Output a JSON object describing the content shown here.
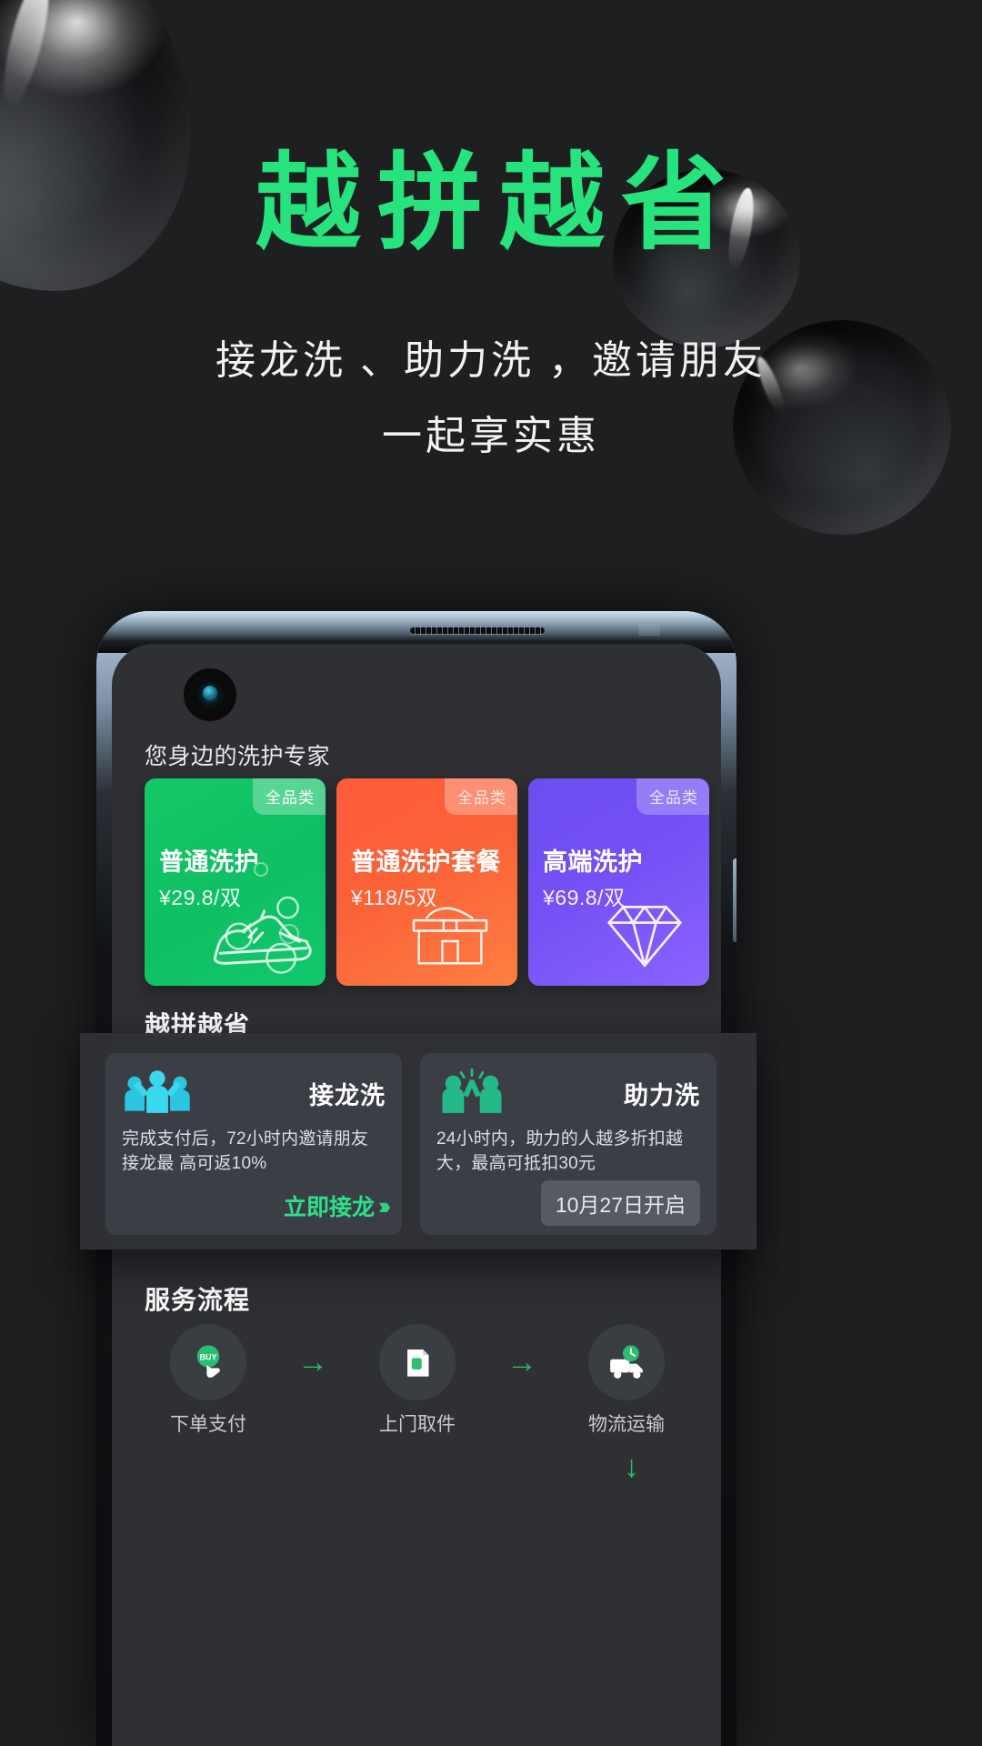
{
  "hero": {
    "title": "越拼越省",
    "subtitle_line1": "接龙洗 、助力洗 ，邀请朋友",
    "subtitle_line2": "一起享实惠",
    "title_color": "#27e37e"
  },
  "phone": {
    "app_header": "您身边的洗护专家",
    "camera_icon": "front-camera-icon",
    "products": [
      {
        "badge": "全品类",
        "name": "普通洗护",
        "price": "¥29.8/双",
        "color": "#0fbf64",
        "art": "sneaker-icon"
      },
      {
        "badge": "全品类",
        "name": "普通洗护套餐",
        "price": "¥118/5双",
        "color": "#fa6238",
        "art": "shoebox-icon"
      },
      {
        "badge": "全品类",
        "name": "高端洗护",
        "price": "¥69.8/双",
        "color": "#7450f5",
        "art": "diamond-icon"
      }
    ],
    "section_pintuan_title": "越拼越省",
    "section_flow_title": "服务流程",
    "flow": {
      "steps": [
        {
          "label": "下单支付",
          "icon": "tap-to-pay-icon"
        },
        {
          "label": "上门取件",
          "icon": "pickup-bag-icon"
        },
        {
          "label": "物流运输",
          "icon": "delivery-truck-icon"
        }
      ],
      "arrow": "→",
      "down_arrow": "↓"
    }
  },
  "promo": {
    "cards": [
      {
        "icon": "group-cheer-icon",
        "icon_color": "#2bc5e0",
        "title": "接龙洗",
        "desc": "完成支付后，72小时内邀请朋友接龙最 高可返10%",
        "cta": "立即接龙",
        "cta_chevron": "›››",
        "cta_color": "#2de08a",
        "date_badge": null
      },
      {
        "icon": "high-five-icon",
        "icon_color": "#25b98a",
        "title": "助力洗",
        "desc": "24小时内，助力的人越多折扣越大，最高可抵扣30元",
        "cta": null,
        "cta_chevron": null,
        "cta_color": null,
        "date_badge": "10月27日开启"
      }
    ]
  }
}
